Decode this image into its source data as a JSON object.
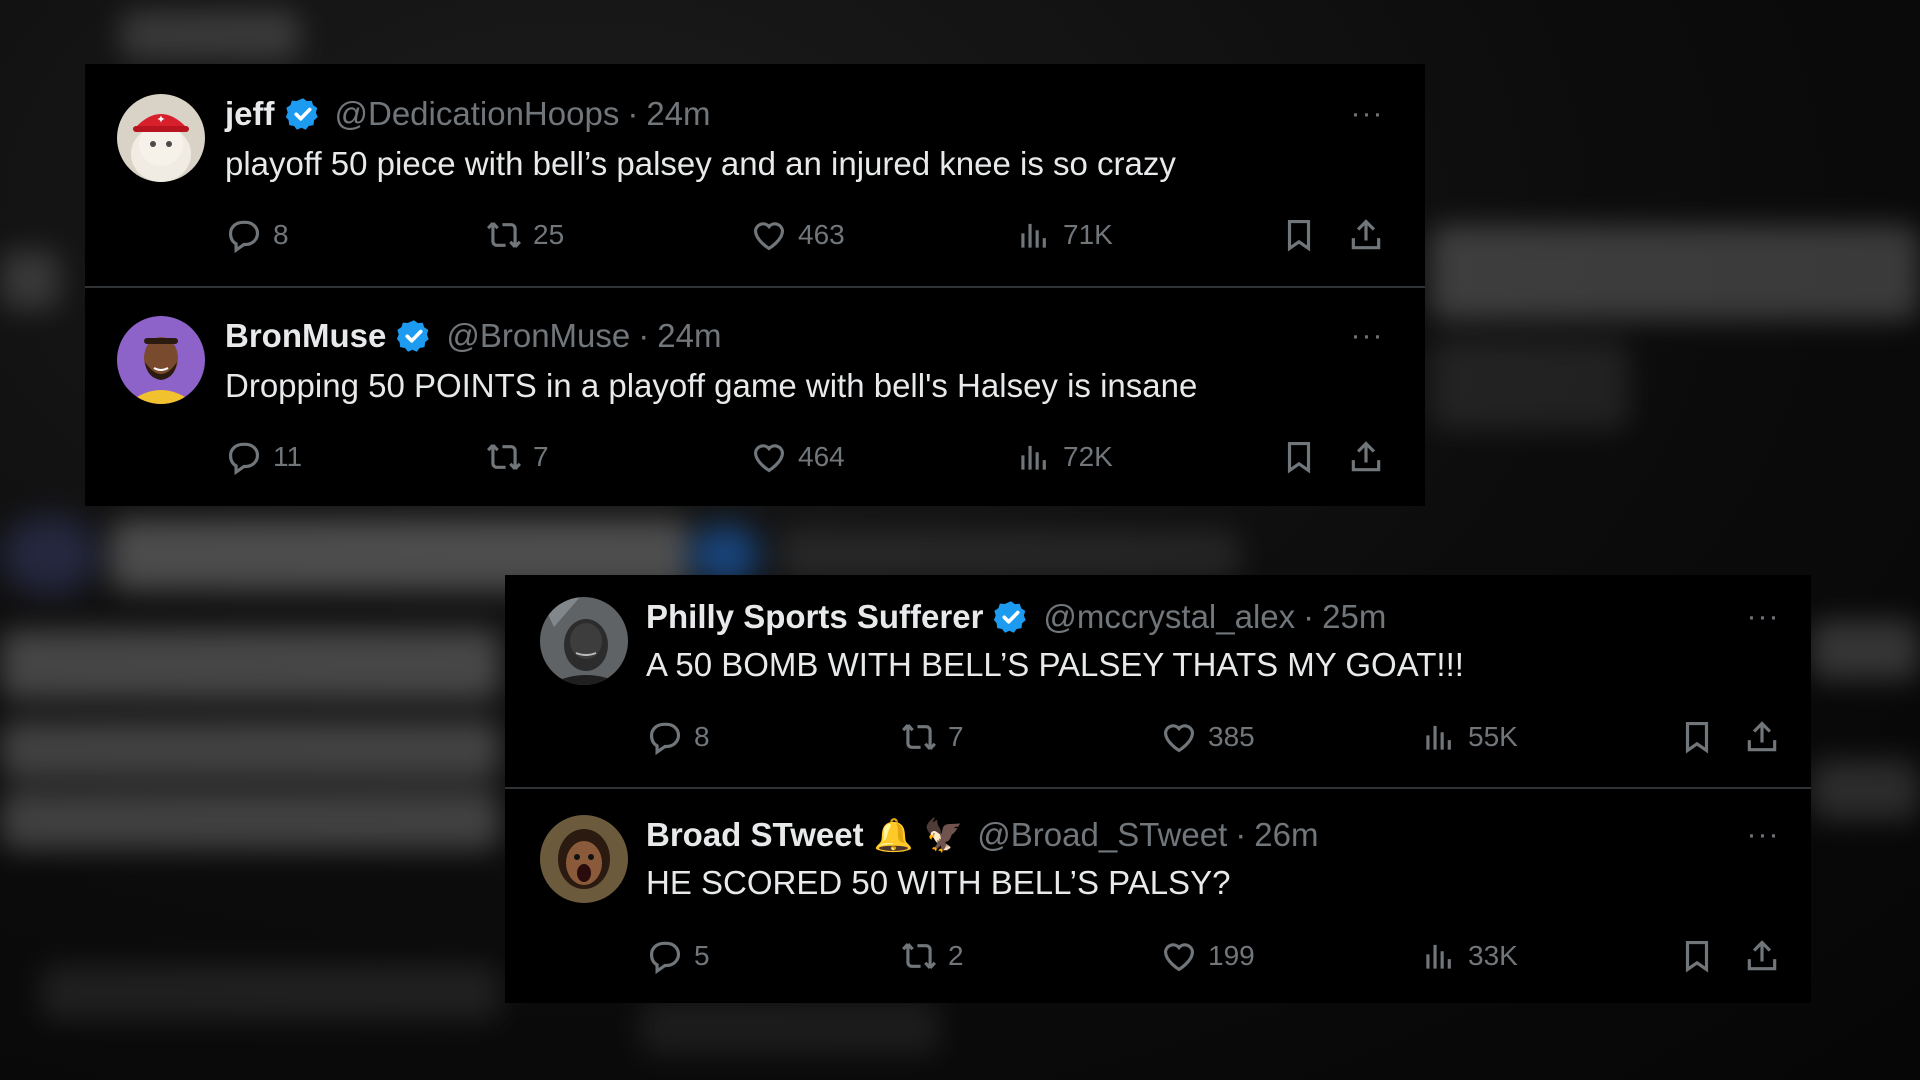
{
  "colors": {
    "background": "#000000",
    "text": "#e7e9ea",
    "muted": "#71767b",
    "verified": "#1d9bf0",
    "divider": "#2f3336"
  },
  "tweets": [
    {
      "name": "jeff",
      "verified": true,
      "badges": [],
      "handle": "@DedicationHoops",
      "time": "24m",
      "text": "playoff 50 piece with bell’s palsey and an injured knee is so crazy",
      "replies": "8",
      "reposts": "25",
      "likes": "463",
      "views": "71K",
      "avatar_icon": "cat-with-red-hat-avatar"
    },
    {
      "name": "BronMuse",
      "verified": true,
      "badges": [],
      "handle": "@BronMuse",
      "time": "24m",
      "text": "Dropping 50 POINTS in a playoff game with bell's Halsey is insane",
      "replies": "11",
      "reposts": "7",
      "likes": "464",
      "views": "72K",
      "avatar_icon": "player-portrait-purple-avatar"
    },
    {
      "name": "Philly Sports Sufferer",
      "verified": true,
      "badges": [],
      "handle": "@mccrystal_alex",
      "time": "25m",
      "text": "A 50 BOMB WITH BELL’S PALSEY THATS MY GOAT!!!",
      "replies": "8",
      "reposts": "7",
      "likes": "385",
      "views": "55K",
      "avatar_icon": "grayscale-player-avatar"
    },
    {
      "name": "Broad STweet",
      "verified": false,
      "badges": [
        "🔔",
        "🦅"
      ],
      "handle": "@Broad_STweet",
      "time": "26m",
      "text": "HE SCORED 50 WITH BELL’S PALSY?",
      "replies": "5",
      "reposts": "2",
      "likes": "199",
      "views": "33K",
      "avatar_icon": "excited-fan-avatar"
    }
  ],
  "ui": {
    "dot": "·",
    "more": "···"
  }
}
